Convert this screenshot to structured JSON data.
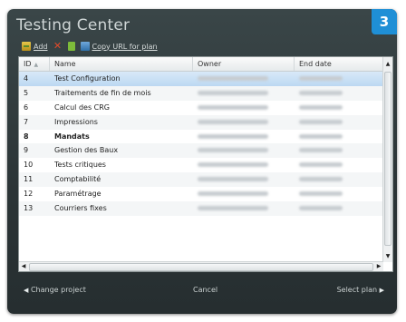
{
  "window": {
    "title": "Testing Center",
    "step_number": "3"
  },
  "toolbar": {
    "add_label": "Add",
    "copy_url_label": "Copy URL for plan"
  },
  "grid": {
    "columns": {
      "id": "ID",
      "name": "Name",
      "owner": "Owner",
      "end_date": "End date"
    },
    "rows": [
      {
        "id": "4",
        "name": "Test Configuration",
        "selected": true,
        "bold": false
      },
      {
        "id": "5",
        "name": "Traitements de fin de mois",
        "selected": false,
        "bold": false
      },
      {
        "id": "6",
        "name": "Calcul des CRG",
        "selected": false,
        "bold": false
      },
      {
        "id": "7",
        "name": "Impressions",
        "selected": false,
        "bold": false
      },
      {
        "id": "8",
        "name": "Mandats",
        "selected": false,
        "bold": true
      },
      {
        "id": "9",
        "name": "Gestion des Baux",
        "selected": false,
        "bold": false
      },
      {
        "id": "10",
        "name": "Tests critiques",
        "selected": false,
        "bold": false
      },
      {
        "id": "11",
        "name": "Comptabilité",
        "selected": false,
        "bold": false
      },
      {
        "id": "12",
        "name": "Paramétrage",
        "selected": false,
        "bold": false
      },
      {
        "id": "13",
        "name": "Courriers fixes",
        "selected": false,
        "bold": false
      }
    ]
  },
  "footer": {
    "change_project_label": "Change project",
    "cancel_label": "Cancel",
    "select_plan_label": "Select plan"
  },
  "colors": {
    "window_bg": "#2b3436",
    "badge": "#1f8fd6",
    "selected_row": "#bcd8f2"
  },
  "icons": [
    "add-icon",
    "delete-icon",
    "document-icon",
    "copy-url-icon",
    "sort-ascending-icon",
    "arrow-left-icon",
    "arrow-right-icon"
  ]
}
